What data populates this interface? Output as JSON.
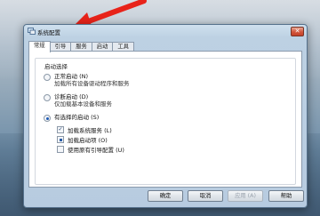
{
  "window": {
    "title": "系统配置",
    "close_label": "✕"
  },
  "tabs": [
    {
      "label": "常规"
    },
    {
      "label": "引导"
    },
    {
      "label": "服务"
    },
    {
      "label": "启动"
    },
    {
      "label": "工具"
    }
  ],
  "startup": {
    "group_label": "启动选择",
    "normal": {
      "label": "正常启动 (N)",
      "desc": "加载所有设备驱动程序和服务"
    },
    "diagnostic": {
      "label": "诊断启动 (D)",
      "desc": "仅加载基本设备和服务"
    },
    "selective": {
      "label": "有选择的启动 (S)",
      "options": [
        {
          "label": "加载系统服务 (L)"
        },
        {
          "label": "加载启动项 (O)"
        },
        {
          "label": "使用原有引导配置 (U)"
        }
      ]
    }
  },
  "buttons": {
    "ok": "确定",
    "cancel": "取消",
    "apply": "应用 (A)",
    "help": "帮助"
  }
}
